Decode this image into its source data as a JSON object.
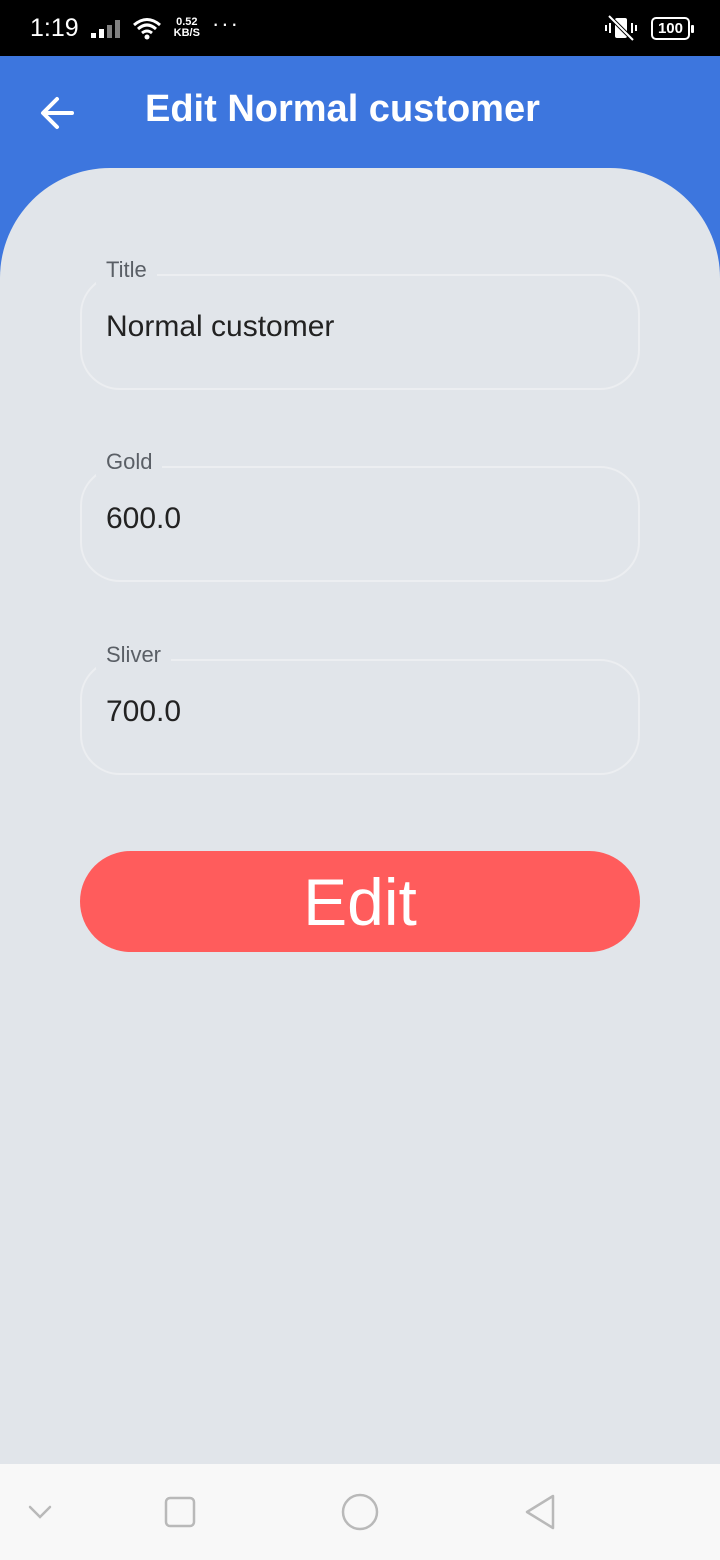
{
  "status_bar": {
    "time": "1:19",
    "speed_value": "0.52",
    "speed_unit": "KB/S",
    "more": "···",
    "battery": "100"
  },
  "app_bar": {
    "title": "Edit Normal customer",
    "back_icon": "arrow-left-icon"
  },
  "form": {
    "fields": [
      {
        "label": "Title",
        "value": "Normal customer"
      },
      {
        "label": "Gold",
        "value": "600.0"
      },
      {
        "label": "Sliver",
        "value": "700.0"
      }
    ],
    "submit_label": "Edit"
  },
  "nav_bar": {
    "icons": [
      "chevron-down-icon",
      "recent-apps-icon",
      "home-icon",
      "back-triangle-icon"
    ]
  },
  "colors": {
    "app_bar": "#3d76de",
    "background": "#e1e5ea",
    "button": "#ff5c5c"
  }
}
